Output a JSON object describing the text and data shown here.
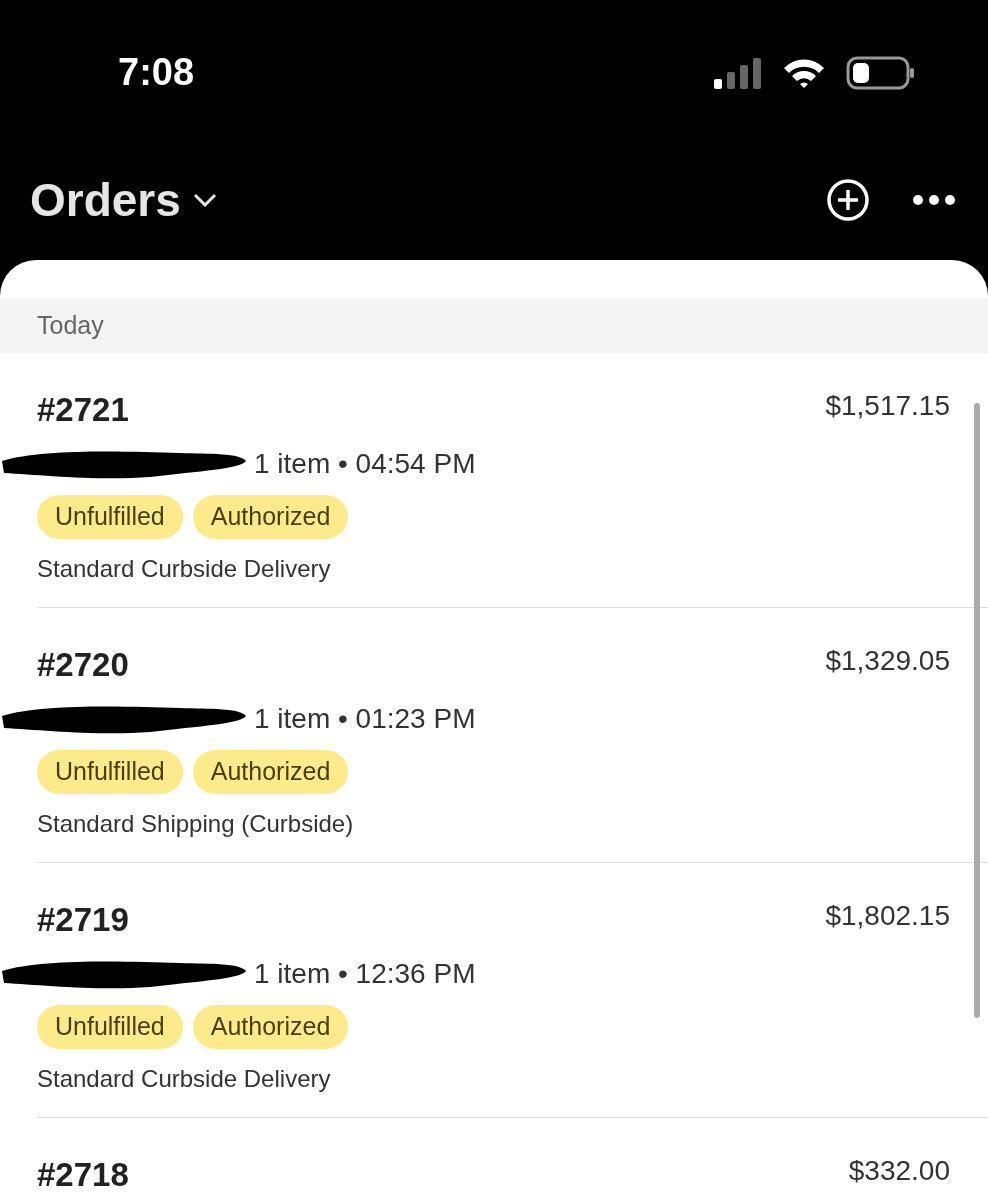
{
  "status_bar": {
    "time": "7:08"
  },
  "header": {
    "title": "Orders"
  },
  "section": {
    "label": "Today"
  },
  "orders": [
    {
      "number": "#2721",
      "total": "$1,517.15",
      "customer_redacted": true,
      "summary": "1 item • 04:54 PM",
      "badges": [
        "Unfulfilled",
        "Authorized"
      ],
      "delivery": "Standard Curbside Delivery"
    },
    {
      "number": "#2720",
      "total": "$1,329.05",
      "customer_redacted": true,
      "summary": "1 item • 01:23 PM",
      "badges": [
        "Unfulfilled",
        "Authorized"
      ],
      "delivery": "Standard Shipping (Curbside)"
    },
    {
      "number": "#2719",
      "total": "$1,802.15",
      "customer_redacted": true,
      "summary": "1 item • 12:36 PM",
      "badges": [
        "Unfulfilled",
        "Authorized"
      ],
      "delivery": "Standard Curbside Delivery"
    },
    {
      "number": "#2718",
      "total": "$332.00"
    }
  ]
}
